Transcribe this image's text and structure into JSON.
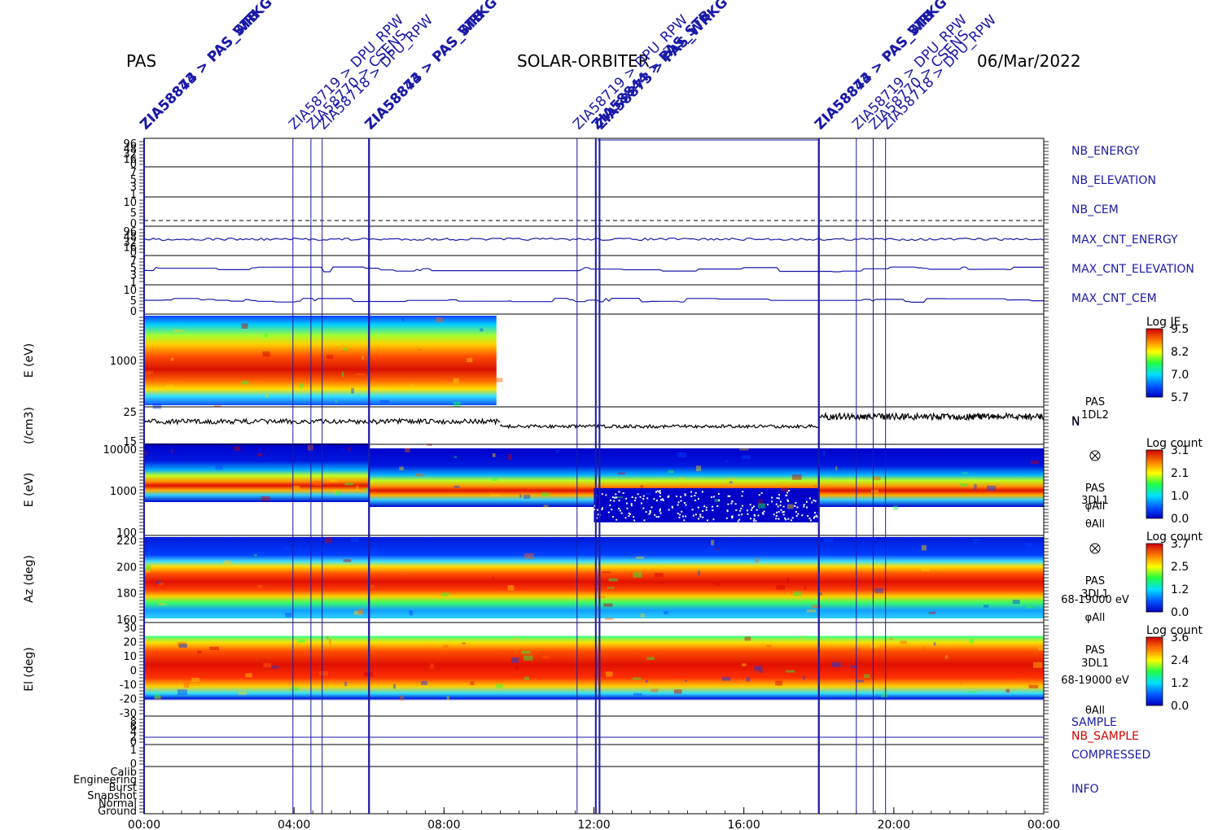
{
  "header": {
    "left": "PAS",
    "center": "SOLAR-ORBITER",
    "right": "06/Mar/2022"
  },
  "colors": {
    "blue": "#1a1aa8",
    "red": "#d00000",
    "black": "#000000"
  },
  "commands": [
    {
      "time": 0.0,
      "label": "ZIA58844 > PAS_STB",
      "bold": true
    },
    {
      "time": 0.0,
      "label": "ZIA58873 > PAS_WRKG",
      "bold": true
    },
    {
      "time": 3.97,
      "label": "ZIA58719 > DPU_RPW",
      "bold": false
    },
    {
      "time": 4.45,
      "label": "ZIA58770 > CSENS",
      "bold": false
    },
    {
      "time": 4.75,
      "label": "ZIA58718 > DPU_RPW",
      "bold": false
    },
    {
      "time": 6.0,
      "label": "ZIA58844 > PAS_STB",
      "bold": true
    },
    {
      "time": 6.0,
      "label": "ZIA58873 > PAS_WRKG",
      "bold": true
    },
    {
      "time": 11.55,
      "label": "ZIA58719 > DPU_RPW",
      "bold": false
    },
    {
      "time": 12.05,
      "label": "ZIA58844 > PAS_STB",
      "bold": true
    },
    {
      "time": 12.15,
      "label": "ZIA58873 > PAS_WRKG",
      "bold": true
    },
    {
      "time": 18.0,
      "label": "ZIA58844 > PAS_STB",
      "bold": true
    },
    {
      "time": 18.0,
      "label": "ZIA58873 > PAS_WRKG",
      "bold": true
    },
    {
      "time": 19.0,
      "label": "ZIA58719 > DPU_RPW",
      "bold": false
    },
    {
      "time": 19.45,
      "label": "ZIA58770 > CSENS",
      "bold": false
    },
    {
      "time": 19.78,
      "label": "ZIA58718 > DPU_RPW",
      "bold": false
    }
  ],
  "chart_data": {
    "type": "heatmap",
    "x_axis": {
      "range_hours": [
        0,
        24
      ],
      "ticks": [
        "00:00",
        "04:00",
        "08:00",
        "12:00",
        "16:00",
        "20:00",
        "00:00"
      ]
    },
    "panels": [
      {
        "id": "nb-energy",
        "right_label": "NB_ENERGY",
        "label_color": "blue",
        "yticks": [
          "96",
          "48",
          "32",
          "16",
          "0"
        ]
      },
      {
        "id": "nb-elevation",
        "right_label": "NB_ELEVATION",
        "label_color": "blue",
        "yticks": [
          "7",
          "5",
          "3",
          "1"
        ]
      },
      {
        "id": "nb-cem",
        "right_label": "NB_CEM",
        "label_color": "blue",
        "yticks": [
          "10",
          "5",
          "0"
        ]
      },
      {
        "id": "max-cnt-energy",
        "right_label": "MAX_CNT_ENERGY",
        "label_color": "blue",
        "yticks": [
          "96",
          "48",
          "32",
          "16",
          "0"
        ]
      },
      {
        "id": "max-cnt-elevation",
        "right_label": "MAX_CNT_ELEVATION",
        "label_color": "blue",
        "yticks": [
          "7",
          "5",
          "3",
          "1"
        ]
      },
      {
        "id": "max-cnt-cem",
        "right_label": "MAX_CNT_CEM",
        "label_color": "blue",
        "yticks": [
          "10",
          "5",
          "0"
        ]
      },
      {
        "id": "energy-je",
        "ylabel": "E (eV)",
        "yticks": [
          "1000"
        ],
        "side": [
          "",
          ""
        ],
        "colorbar": {
          "title": "Log JE",
          "ticks": [
            "9.5",
            "8.2",
            "7.0",
            "5.7"
          ]
        },
        "data_hours": [
          0,
          9.4
        ]
      },
      {
        "id": "density",
        "ylabel": "(/cm3)",
        "yticks": [
          "25",
          "15"
        ],
        "side": [
          "PAS",
          "1DL2"
        ],
        "right_label": "N"
      },
      {
        "id": "energy-3dl1",
        "ylabel": "E (eV)",
        "yticks": [
          "10000",
          "1000",
          "100"
        ],
        "side": [
          "PAS",
          "3DL1",
          "φAll",
          "θAll"
        ],
        "colorbar": {
          "title": "Log count",
          "ticks": [
            "3.1",
            "2.1",
            "1.0",
            "0.0"
          ]
        }
      },
      {
        "id": "azimuth",
        "ylabel": "Az (deg)",
        "yticks": [
          "220",
          "200",
          "180",
          "160"
        ],
        "side": [
          "PAS",
          "3DL1",
          "68-19000 eV",
          "φAll"
        ],
        "colorbar": {
          "title": "Log count",
          "ticks": [
            "3.7",
            "2.5",
            "1.2",
            "0.0"
          ]
        }
      },
      {
        "id": "elevation",
        "ylabel": "El (deg)",
        "yticks": [
          "30",
          "20",
          "10",
          "0",
          "-10",
          "-20",
          "-30"
        ],
        "side": [
          "PAS",
          "3DL1",
          "68-19000 eV",
          "θAll"
        ],
        "colorbar": {
          "title": "Log count",
          "ticks": [
            "3.6",
            "2.4",
            "1.2",
            "0.0"
          ]
        }
      },
      {
        "id": "sample",
        "right_label": "SAMPLE",
        "right_label2": "NB_SAMPLE",
        "label_color": "blue",
        "label2_color": "red",
        "yticks": [
          "8",
          "6",
          "4",
          "2",
          "0"
        ]
      },
      {
        "id": "compressed",
        "right_label": "COMPRESSED",
        "label_color": "blue",
        "yticks": [
          "1",
          "0"
        ]
      },
      {
        "id": "info",
        "right_label": "INFO",
        "label_color": "blue",
        "yticks": [
          "Calib",
          "Engineering",
          "Burst",
          "Snapshot",
          "Normal",
          "Ground"
        ]
      }
    ]
  }
}
